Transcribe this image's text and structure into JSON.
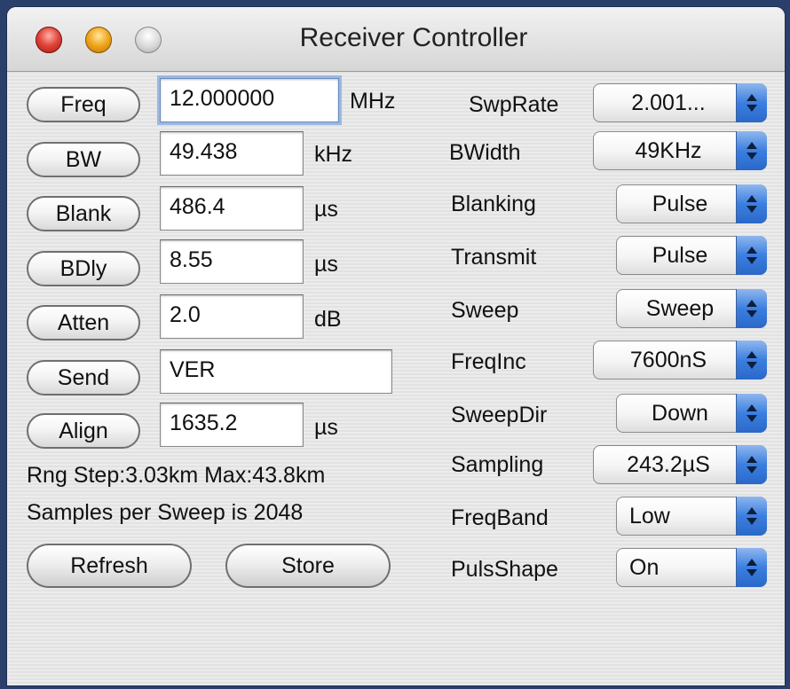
{
  "window": {
    "title": "Receiver Controller"
  },
  "params": [
    {
      "button": "Freq",
      "value": "12.000000",
      "unit": "MHz"
    },
    {
      "button": "BW",
      "value": "49.438",
      "unit": "kHz"
    },
    {
      "button": "Blank",
      "value": "486.4",
      "unit": "µs"
    },
    {
      "button": "BDly",
      "value": "8.55",
      "unit": "µs"
    },
    {
      "button": "Atten",
      "value": "2.0",
      "unit": "dB"
    },
    {
      "button": "Send",
      "value": "VER",
      "unit": ""
    },
    {
      "button": "Align",
      "value": "1635.2",
      "unit": "µs"
    }
  ],
  "info": {
    "range": "Rng Step:3.03km Max:43.8km",
    "samples": "Samples per Sweep is 2048"
  },
  "actions": {
    "refresh": "Refresh",
    "store": "Store"
  },
  "settings": [
    {
      "label": "SwpRate",
      "value": "2.001..."
    },
    {
      "label": "BWidth",
      "value": "49KHz"
    },
    {
      "label": "Blanking",
      "value": "Pulse"
    },
    {
      "label": "Transmit",
      "value": "Pulse"
    },
    {
      "label": "Sweep",
      "value": "Sweep"
    },
    {
      "label": "FreqInc",
      "value": "7600nS"
    },
    {
      "label": "SweepDir",
      "value": "Down"
    },
    {
      "label": "Sampling",
      "value": "243.2µS"
    },
    {
      "label": "FreqBand",
      "value": "Low"
    },
    {
      "label": "PulsShape",
      "value": "On"
    }
  ],
  "icons": {
    "close": "close-icon",
    "minimize": "minimize-icon",
    "zoom": "zoom-icon",
    "select_arrows": "up-down-arrows-icon"
  },
  "colors": {
    "accent": "#3b7fe0",
    "close": "#e0443a",
    "minimize": "#f0a81e",
    "focus_ring": "#9bb9e0"
  }
}
